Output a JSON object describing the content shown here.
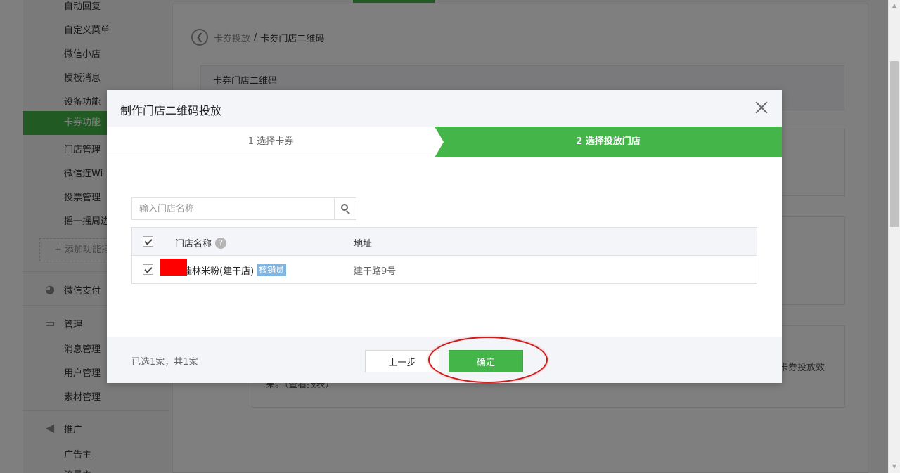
{
  "sidebar": {
    "items": [
      {
        "label": "自动回复"
      },
      {
        "label": "自定义菜单"
      },
      {
        "label": "微信小店"
      },
      {
        "label": "模板消息"
      },
      {
        "label": "设备功能"
      },
      {
        "label": "卡券功能"
      },
      {
        "label": "门店管理"
      },
      {
        "label": "微信连Wi-Fi"
      },
      {
        "label": "投票管理"
      },
      {
        "label": "摇一摇周边"
      }
    ],
    "add_feature": "+ 添加功能插件",
    "groups": {
      "wechat_pay": {
        "label": "微信支付",
        "icon": "wechat-pay-icon"
      },
      "manage": {
        "label": "管理",
        "icon": "inbox-icon"
      },
      "promote": {
        "label": "推广",
        "icon": "megaphone-icon"
      }
    },
    "manage_items": [
      {
        "label": "消息管理"
      },
      {
        "label": "用户管理"
      },
      {
        "label": "素材管理"
      }
    ],
    "promote_items": [
      {
        "label": "广告主"
      },
      {
        "label": "流量主"
      }
    ]
  },
  "breadcrumb": {
    "parent": "卡券投放",
    "separator": "/",
    "current": "卡券门店二维码"
  },
  "info_bar": {
    "title": "卡券门店二维码"
  },
  "background_tail": {
    "line1": "卡券投放效",
    "line2": "果。（查看报表）"
  },
  "modal": {
    "title": "制作门店二维码投放",
    "steps": [
      {
        "label": "1 选择卡券"
      },
      {
        "label": "2 选择投放门店"
      }
    ],
    "search": {
      "placeholder": "输入门店名称"
    },
    "table": {
      "headers": {
        "name": "门店名称",
        "address": "地址"
      },
      "rows": [
        {
          "name": "桂林米粉(建干店)",
          "badge": "核销员",
          "address": "建干路9号"
        }
      ]
    },
    "footer": {
      "selected_text": "已选1家，共1家",
      "prev_label": "上一步",
      "confirm_label": "确定"
    }
  },
  "colors": {
    "accent": "#44b549",
    "badge": "#7fb5e0",
    "annotation": "#d11a1a",
    "redaction": "#ff0000"
  }
}
